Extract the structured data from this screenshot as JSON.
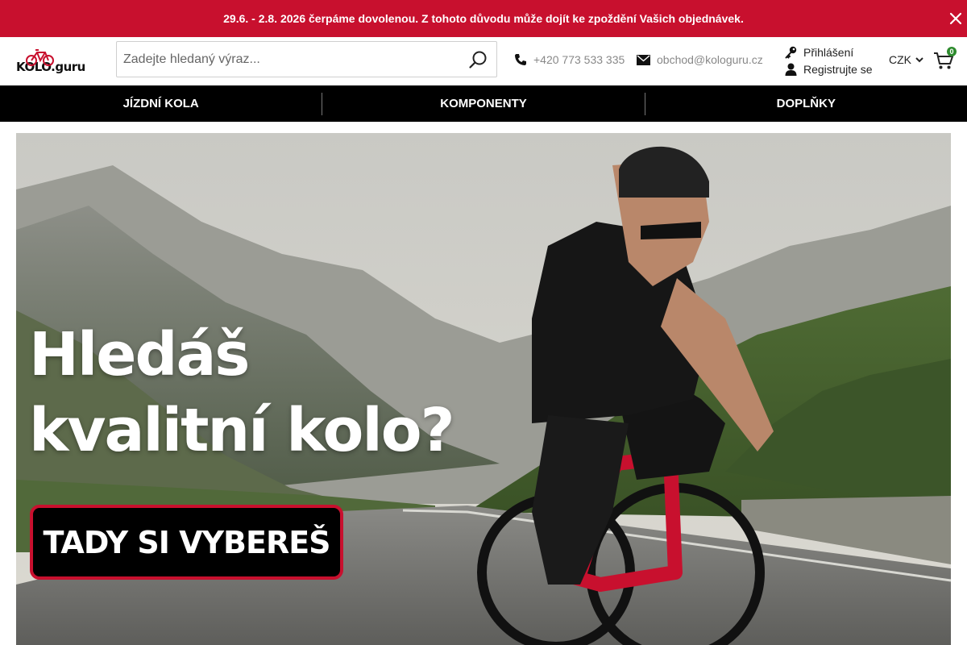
{
  "announcement": {
    "text": "29.6. - 2.8. 2026 čerpáme dovolenou. Z tohoto důvodu může dojít ke zpoždění Vašich objednávek.",
    "close_icon": "close-icon",
    "background": "#c8102e"
  },
  "header": {
    "logo_text": "KOLO.guru",
    "search_placeholder": "Zadejte hledaný výraz...",
    "search_icon": "search-icon",
    "phone": "+420 773 533 335",
    "email": "obchod@kologuru.cz",
    "login": "Přihlášení",
    "register": "Registrujte se",
    "currency": "CZK",
    "cart_count": "0"
  },
  "nav": {
    "items": [
      {
        "label": "JÍZDNÍ KOLA"
      },
      {
        "label": "KOMPONENTY"
      },
      {
        "label": "DOPLŇKY"
      }
    ]
  },
  "hero": {
    "title_line1": "Hledáš",
    "title_line2": "kvalitní kolo?",
    "cta": "TADY SI VYBEREŠ",
    "accent": "#c8102e"
  }
}
